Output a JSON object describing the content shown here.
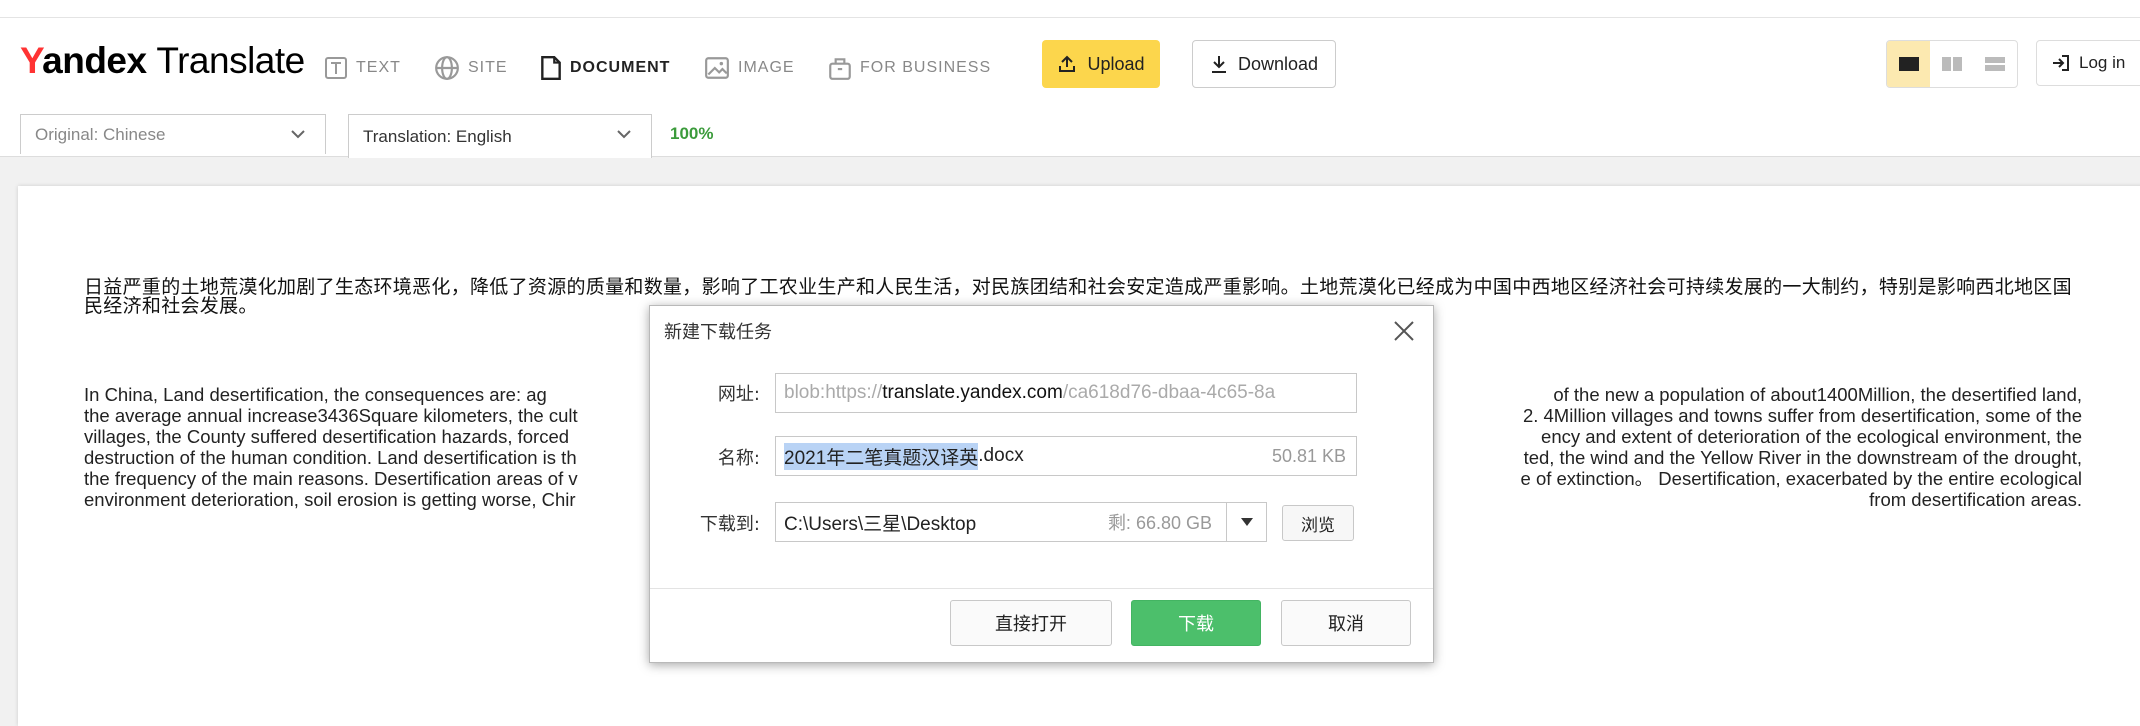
{
  "logo": {
    "y": "Y",
    "andex": "andex",
    "translate": "Translate"
  },
  "nav": {
    "text": "TEXT",
    "site": "SITE",
    "document": "DOCUMENT",
    "image": "IMAGE",
    "business": "FOR BUSINESS"
  },
  "toolbar": {
    "upload": "Upload",
    "download": "Download",
    "login": "Log in"
  },
  "languages": {
    "original": "Original: Chinese",
    "translation": "Translation: English",
    "progress": "100%"
  },
  "document": {
    "chinese": "日益严重的土地荒漠化加剧了生态环境恶化，降低了资源的质量和数量，影响了工农业生产和人民生活，对民族团结和社会安定造成严重影响。土地荒漠化已经成为中国中西地区经济社会可持续发展的一大制约，特别是影响西北地区国民经济和社会发展。",
    "english_left": [
      "In China, Land desertification, the consequences are: ag",
      "the average annual increase3436Square kilometers, the cult",
      "villages, the County suffered desertification hazards, forced",
      "destruction of the human condition. Land desertification is th",
      "the frequency of the main reasons. Desertification areas of v",
      "environment deterioration, soil erosion is getting worse, Chir"
    ],
    "english_right": [
      "of the new a population of about1400Million, the desertified land,",
      "2. 4Million villages and towns suffer from desertification, some of the",
      "ency and extent of deterioration of the ecological environment, the",
      "ted, the wind and the Yellow River in the downstream of the drought,",
      "e of extinction。 Desertification, exacerbated by the entire ecological",
      "from desertification areas."
    ]
  },
  "dialog": {
    "title": "新建下载任务",
    "url_label": "网址:",
    "url_prefix": "blob:https://",
    "url_host": "translate.yandex.com",
    "url_suffix": "/ca618d76-dbaa-4c65-8a",
    "name_label": "名称:",
    "name_selected": "2021年二笔真题汉译英",
    "name_ext": ".docx",
    "name_size": "50.81 KB",
    "path_label": "下载到:",
    "path_value": "C:\\Users\\三星\\Desktop",
    "path_free": "剩: 66.80 GB",
    "browse": "浏览",
    "open_direct": "直接打开",
    "download": "下载",
    "cancel": "取消"
  }
}
